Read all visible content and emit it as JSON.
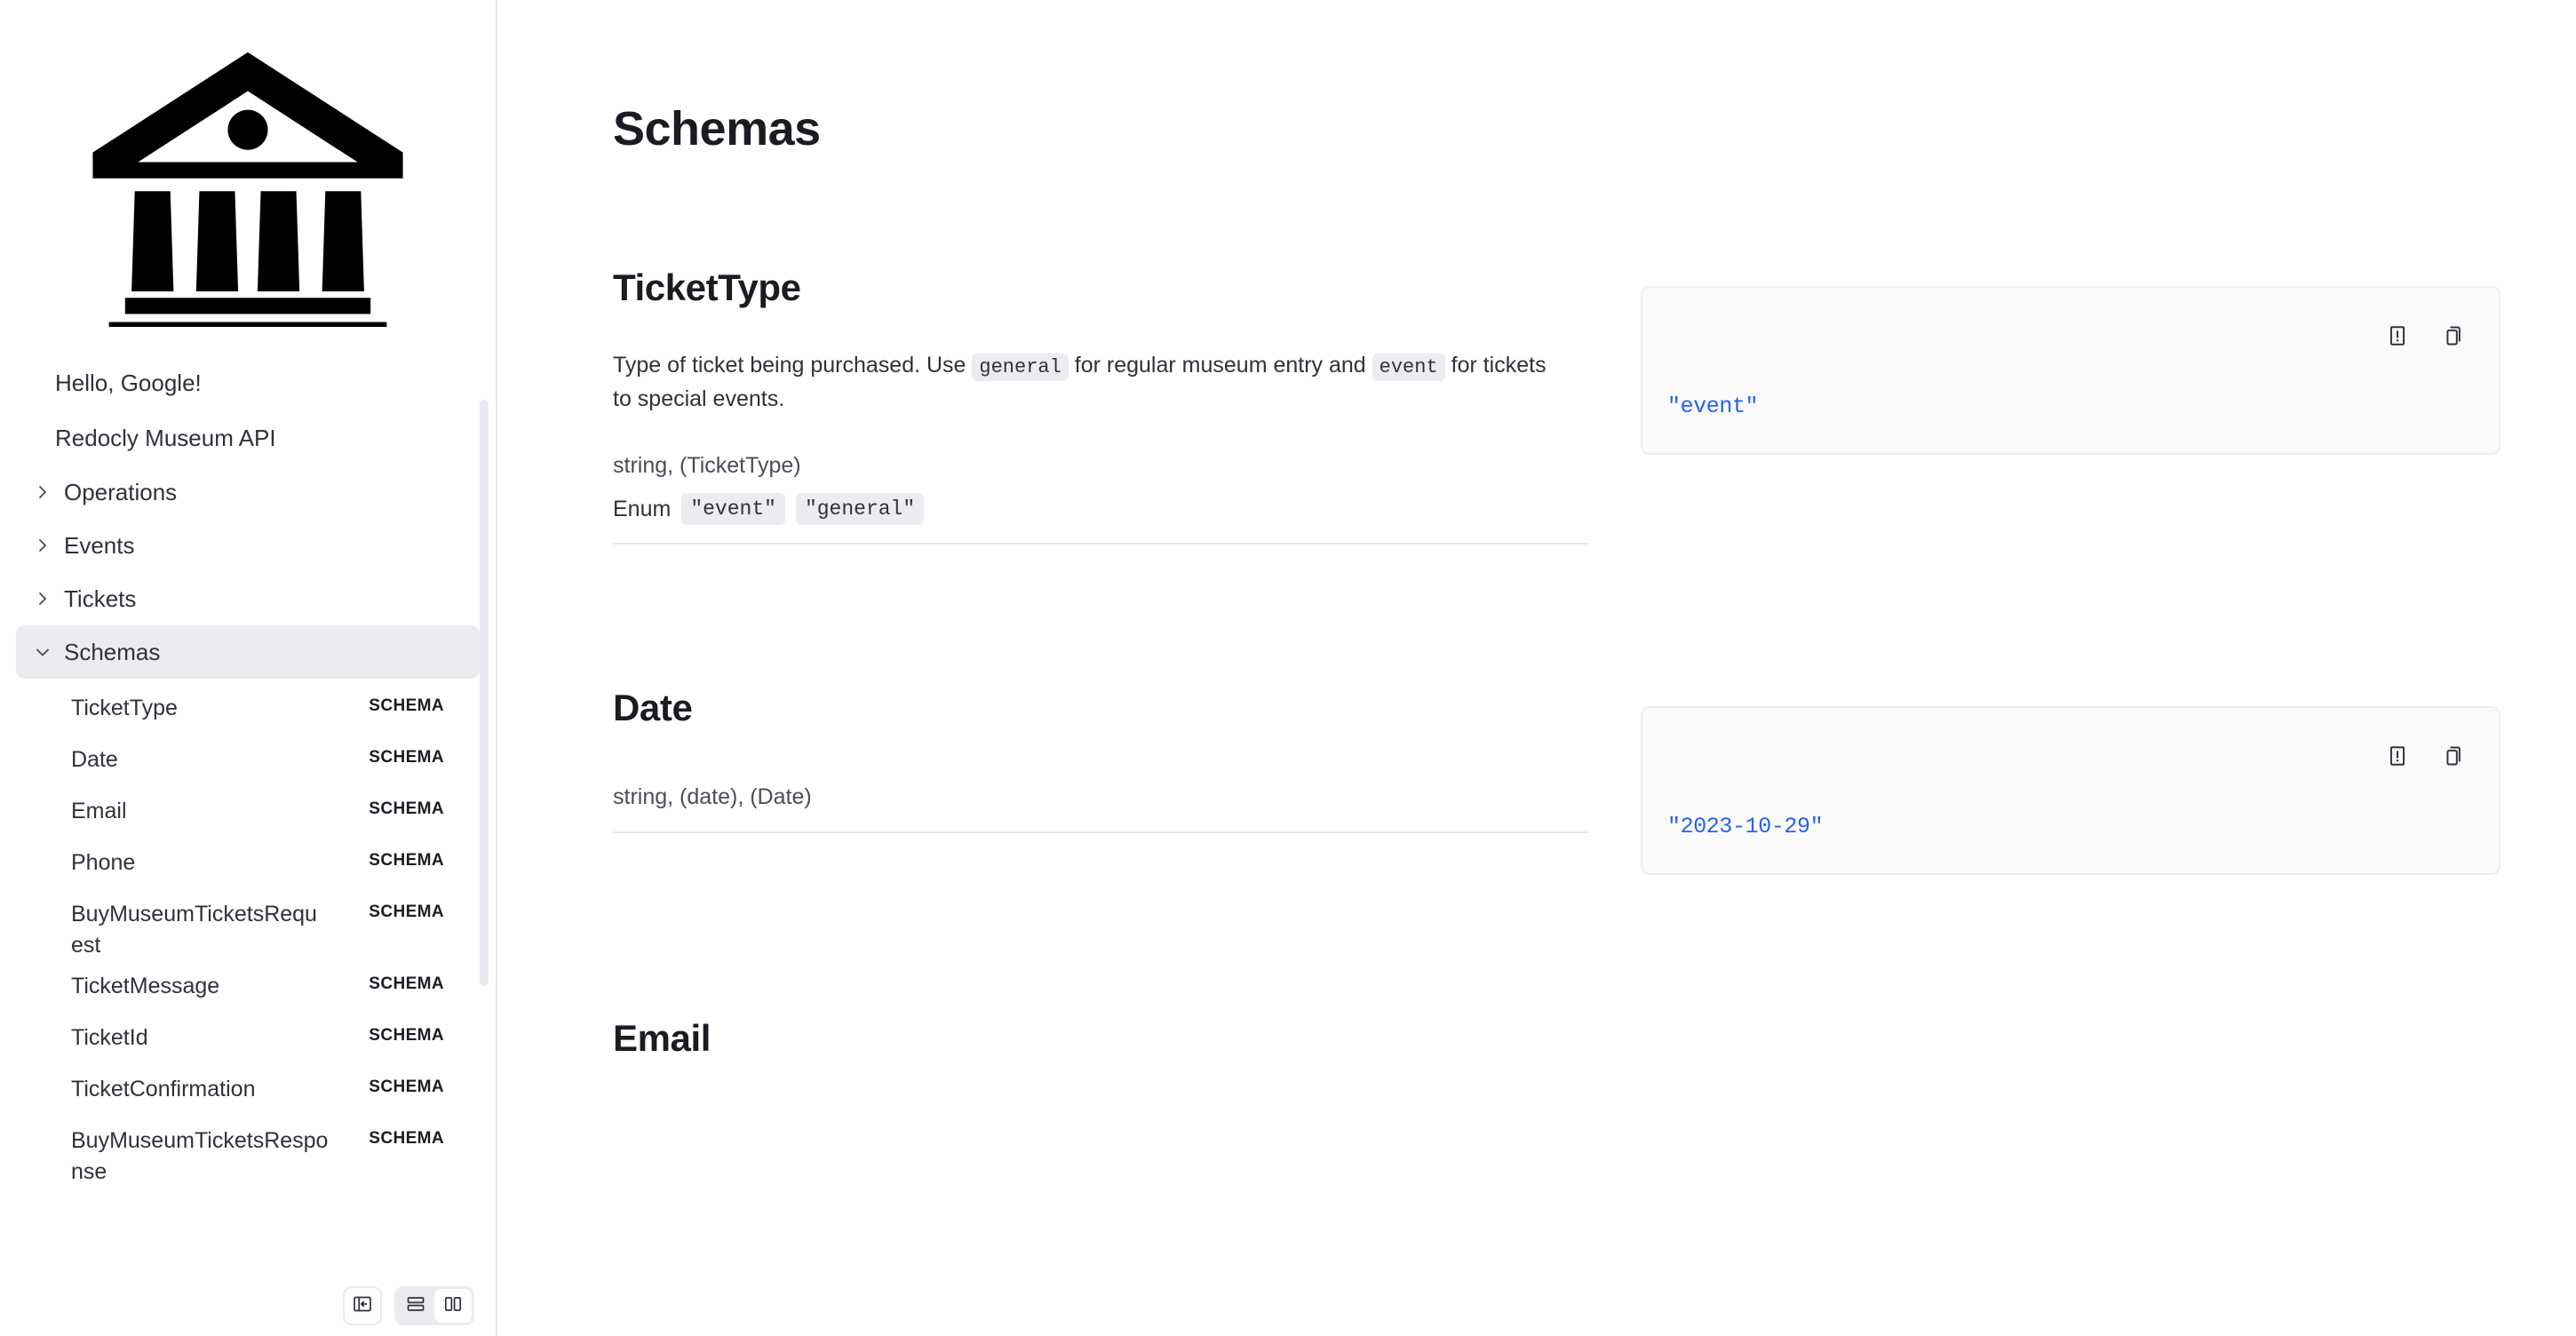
{
  "sidebar": {
    "logo_icon": "museum-building-icon",
    "greeting": "Hello, Google!",
    "api_title": "Redocly Museum API",
    "groups": [
      {
        "label": "Operations",
        "icon": "chevron-right-icon",
        "expanded": false
      },
      {
        "label": "Events",
        "icon": "chevron-right-icon",
        "expanded": false
      },
      {
        "label": "Tickets",
        "icon": "chevron-right-icon",
        "expanded": false
      },
      {
        "label": "Schemas",
        "icon": "chevron-down-icon",
        "expanded": true
      }
    ],
    "schema_items": [
      {
        "name": "TicketType",
        "badge": "SCHEMA"
      },
      {
        "name": "Date",
        "badge": "SCHEMA"
      },
      {
        "name": "Email",
        "badge": "SCHEMA"
      },
      {
        "name": "Phone",
        "badge": "SCHEMA"
      },
      {
        "name": "BuyMuseumTicketsRequest",
        "badge": "SCHEMA"
      },
      {
        "name": "TicketMessage",
        "badge": "SCHEMA"
      },
      {
        "name": "TicketId",
        "badge": "SCHEMA"
      },
      {
        "name": "TicketConfirmation",
        "badge": "SCHEMA"
      },
      {
        "name": "BuyMuseumTicketsResponse",
        "badge": "SCHEMA"
      }
    ],
    "toolbar": {
      "collapse_icon": "collapse-sidebar-icon",
      "single_column_icon": "single-column-layout-icon",
      "two_column_icon": "two-column-layout-icon",
      "selected_layout": "two-column"
    }
  },
  "main": {
    "page_title": "Schemas",
    "sections": [
      {
        "title": "TicketType",
        "desc_parts": [
          {
            "t": "text",
            "v": "Type of ticket being purchased. Use "
          },
          {
            "t": "code",
            "v": "general"
          },
          {
            "t": "text",
            "v": " for regular museum entry and "
          },
          {
            "t": "code",
            "v": "event"
          },
          {
            "t": "text",
            "v": " for tickets to special events."
          }
        ],
        "type_line": "string, (TicketType)",
        "enum_label": "Enum",
        "enum_values": [
          "\"event\"",
          "\"general\""
        ],
        "sample": "\"event\"",
        "report_icon": "report-issue-icon",
        "copy_icon": "copy-icon"
      },
      {
        "title": "Date",
        "desc_parts": [],
        "type_line": "string, (date), (Date)",
        "enum_label": "",
        "enum_values": [],
        "sample": "\"2023-10-29\"",
        "report_icon": "report-issue-icon",
        "copy_icon": "copy-icon"
      },
      {
        "title": "Email",
        "desc_parts": [],
        "type_line": "",
        "enum_label": "",
        "enum_values": [],
        "sample": "",
        "report_icon": "report-issue-icon",
        "copy_icon": "copy-icon"
      }
    ]
  },
  "colors": {
    "accent_string": "#2563eb",
    "active_nav_bg": "#ebebf0",
    "code_panel_bg": "#fafafb",
    "text_primary": "#1b1b22",
    "text_body": "#31313c"
  }
}
